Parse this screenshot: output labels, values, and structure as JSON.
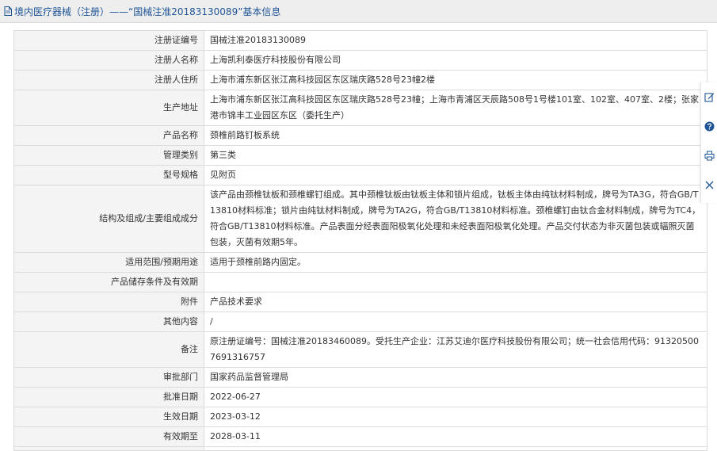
{
  "header": {
    "title": "境内医疗器械（注册）——“国械注准20183130089”基本信息",
    "title_color": "#1f5596"
  },
  "rows": [
    {
      "label": "注册证编号",
      "value": "国械注准20183130089"
    },
    {
      "label": "注册人名称",
      "value": "上海凯利泰医疗科技股份有限公司"
    },
    {
      "label": "注册人住所",
      "value": "上海市浦东新区张江高科技园区东区瑞庆路528号23幢2楼"
    },
    {
      "label": "生产地址",
      "value": "上海市浦东新区张江高科技园区东区瑞庆路528号23幢；上海市青浦区天辰路508号1号楼101室、102室、407室、2楼；张家港市锦丰工业园区东区（委托生产）"
    },
    {
      "label": "产品名称",
      "value": "颈椎前路钉板系统"
    },
    {
      "label": "管理类别",
      "value": "第三类"
    },
    {
      "label": "型号规格",
      "value": "见附页"
    },
    {
      "label": "结构及组成/主要组成成分",
      "value": "该产品由颈椎钛板和颈椎螺钉组成。其中颈椎钛板由钛板主体和锁片组成，钛板主体由纯钛材料制成，牌号为TA3G，符合GB/T13810材料标准；锁片由纯钛材料制成，牌号为TA2G，符合GB/T13810材料标准。颈椎螺钉由钛合金材料制成，牌号为TC4，符合GB/T13810材料标准。产品表面分经表面阳极氧化处理和未经表面阳极氧化处理。产品交付状态为非灭菌包装或辐照灭菌包装，灭菌有效期5年。"
    },
    {
      "label": "适用范围/预期用途",
      "value": "适用于颈椎前路内固定。"
    },
    {
      "label": "产品储存条件及有效期",
      "value": ""
    },
    {
      "label": "附件",
      "value": "产品技术要求"
    },
    {
      "label": "其他内容",
      "value": "/"
    },
    {
      "label": "备注",
      "value": "原注册证编号：国械注准20183460089。受托生产企业：江苏艾迪尔医疗科技股份有限公司；统一社会信用代码：913205007691316757"
    },
    {
      "label": "审批部门",
      "value": "国家药品监督管理局"
    },
    {
      "label": "批准日期",
      "value": "2022-06-27"
    },
    {
      "label": "生效日期",
      "value": "2023-03-12"
    },
    {
      "label": "有效期至",
      "value": "2028-03-11"
    },
    {
      "label": "",
      "value": ""
    }
  ],
  "side_tools": [
    {
      "icon": "edit-icon"
    },
    {
      "icon": "help-icon"
    },
    {
      "icon": "print-icon"
    },
    {
      "icon": "close-icon"
    }
  ],
  "colors": {
    "accent": "#1f5596",
    "label_bg": "#f4f4f4",
    "border": "#dcdcdc"
  }
}
